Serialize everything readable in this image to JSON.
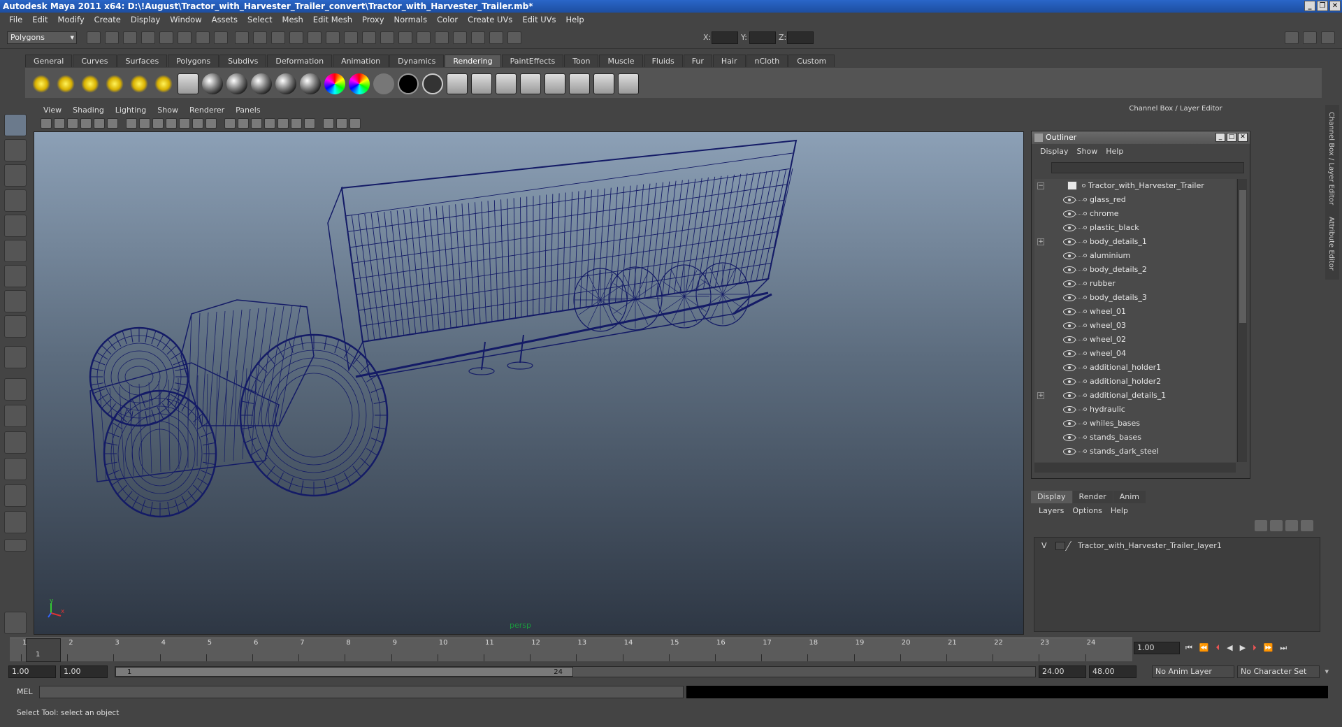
{
  "window": {
    "title": "Autodesk Maya 2011 x64: D:\\!August\\Tractor_with_Harvester_Trailer_convert\\Tractor_with_Harvester_Trailer.mb*"
  },
  "menubar": [
    "File",
    "Edit",
    "Modify",
    "Create",
    "Display",
    "Window",
    "Assets",
    "Select",
    "Mesh",
    "Edit Mesh",
    "Proxy",
    "Normals",
    "Color",
    "Create UVs",
    "Edit UVs",
    "Help"
  ],
  "statusline": {
    "mode": "Polygons",
    "x_label": "X:",
    "y_label": "Y:",
    "z_label": "Z:"
  },
  "shelf": {
    "tabs": [
      "General",
      "Curves",
      "Surfaces",
      "Polygons",
      "Subdivs",
      "Deformation",
      "Animation",
      "Dynamics",
      "Rendering",
      "PaintEffects",
      "Toon",
      "Muscle",
      "Fluids",
      "Fur",
      "Hair",
      "nCloth",
      "Custom"
    ],
    "active_tab": "Rendering",
    "icons": [
      "ambient-light",
      "directional-light",
      "point-light",
      "spot-light",
      "area-light",
      "volume-light",
      "ibl-icon",
      "blinn-sphere",
      "lambert-sphere",
      "phong-sphere",
      "phonge-sphere",
      "anisotropic-sphere",
      "ramp-sphere",
      "layered-sphere",
      "surface-sphere",
      "black-sphere",
      "outline-sphere",
      "hypershade",
      "render-view",
      "render-settings",
      "ipr-render",
      "render-current",
      "batch-render",
      "render-layer",
      "paint-effects"
    ]
  },
  "viewport": {
    "menu": [
      "View",
      "Shading",
      "Lighting",
      "Show",
      "Renderer",
      "Panels"
    ],
    "camera_label": "persp",
    "axis_x": "x",
    "axis_y": "y",
    "wire_color": "#141b66"
  },
  "channel_box": {
    "title": "Channel Box / Layer Editor",
    "side_tab_channel": "Channel Box / Layer Editor",
    "side_tab_attribute": "Attribute Editor"
  },
  "outliner": {
    "title": "Outliner",
    "menu": [
      "Display",
      "Show",
      "Help"
    ],
    "root": "Tractor_with_Harvester_Trailer",
    "items": [
      {
        "name": "glass_red",
        "expand": ""
      },
      {
        "name": "chrome",
        "expand": ""
      },
      {
        "name": "plastic_black",
        "expand": ""
      },
      {
        "name": "body_details_1",
        "expand": "+"
      },
      {
        "name": "aluminium",
        "expand": ""
      },
      {
        "name": "body_details_2",
        "expand": ""
      },
      {
        "name": "rubber",
        "expand": ""
      },
      {
        "name": "body_details_3",
        "expand": ""
      },
      {
        "name": "wheel_01",
        "expand": ""
      },
      {
        "name": "wheel_03",
        "expand": ""
      },
      {
        "name": "wheel_02",
        "expand": ""
      },
      {
        "name": "wheel_04",
        "expand": ""
      },
      {
        "name": "additional_holder1",
        "expand": ""
      },
      {
        "name": "additional_holder2",
        "expand": ""
      },
      {
        "name": "additional_details_1",
        "expand": "+"
      },
      {
        "name": "hydraulic",
        "expand": ""
      },
      {
        "name": "whiles_bases",
        "expand": ""
      },
      {
        "name": "stands_bases",
        "expand": ""
      },
      {
        "name": "stands_dark_steel",
        "expand": ""
      }
    ]
  },
  "layer_editor": {
    "tabs": [
      "Display",
      "Render",
      "Anim"
    ],
    "active_tab": "Display",
    "menu": [
      "Layers",
      "Options",
      "Help"
    ],
    "layer": {
      "visible": "V",
      "name": "Tractor_with_Harvester_Trailer_layer1"
    }
  },
  "timeline": {
    "ticks": [
      "1",
      "2",
      "3",
      "4",
      "5",
      "6",
      "7",
      "8",
      "9",
      "10",
      "11",
      "12",
      "13",
      "14",
      "15",
      "16",
      "17",
      "18",
      "19",
      "20",
      "21",
      "22",
      "23",
      "24"
    ],
    "current_frame_marker": "1",
    "current_frame": "1.00"
  },
  "range": {
    "start": "1.00",
    "playback_start": "1.00",
    "slider_start": "1",
    "slider_end": "24",
    "playback_end": "24.00",
    "end": "48.00",
    "anim_layer": "No Anim Layer",
    "character_set": "No Character Set"
  },
  "command_line": {
    "label": "MEL"
  },
  "help_line": "Select Tool: select an object"
}
